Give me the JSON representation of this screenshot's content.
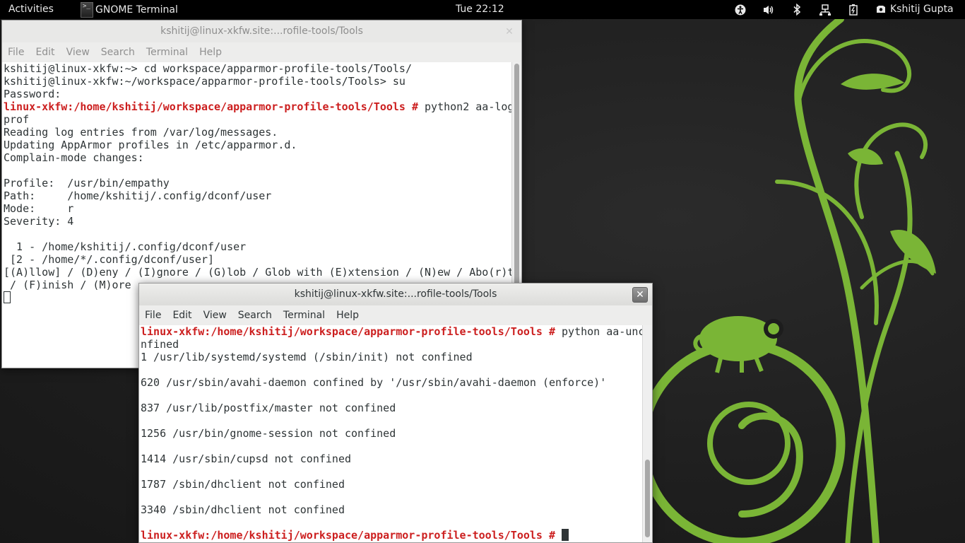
{
  "topbar": {
    "activities": "Activities",
    "app_name": "GNOME Terminal",
    "clock": "Tue 22:12",
    "user_name": "Kshitij Gupta",
    "tray_icons": [
      "accessibility-icon",
      "volume-icon",
      "bluetooth-icon",
      "network-icon",
      "battery-icon"
    ]
  },
  "menu": [
    "File",
    "Edit",
    "View",
    "Search",
    "Terminal",
    "Help"
  ],
  "window1": {
    "title": "kshitij@linux-xkfw.site:...rofile-tools/Tools",
    "lines": [
      {
        "text": "kshitij@linux-xkfw:~> cd workspace/apparmor-profile-tools/Tools/"
      },
      {
        "text": "kshitij@linux-xkfw:~/workspace/apparmor-profile-tools/Tools> su"
      },
      {
        "text": "Password:"
      },
      {
        "prompt": "linux-xkfw:/home/kshitij/workspace/apparmor-profile-tools/Tools #",
        "text": " python2 aa-log"
      },
      {
        "text": "prof"
      },
      {
        "text": "Reading log entries from /var/log/messages."
      },
      {
        "text": "Updating AppArmor profiles in /etc/apparmor.d."
      },
      {
        "text": "Complain-mode changes:"
      },
      {
        "text": ""
      },
      {
        "text": "Profile:  /usr/bin/empathy"
      },
      {
        "text": "Path:     /home/kshitij/.config/dconf/user"
      },
      {
        "text": "Mode:     r"
      },
      {
        "text": "Severity: 4"
      },
      {
        "text": ""
      },
      {
        "text": "  1 - /home/kshitij/.config/dconf/user"
      },
      {
        "text": " [2 - /home/*/.config/dconf/user]"
      },
      {
        "text": "[(A)llow] / (D)eny / (I)gnore / (G)lob / Glob with (E)xtension / (N)ew / Abo(r)t"
      },
      {
        "text": " / (F)inish / (M)ore"
      }
    ]
  },
  "window2": {
    "title": "kshitij@linux-xkfw.site:...rofile-tools/Tools",
    "lines": [
      {
        "prompt": "linux-xkfw:/home/kshitij/workspace/apparmor-profile-tools/Tools #",
        "text": " python aa-unc"
      },
      {
        "text": "nfined"
      },
      {
        "text": "1 /usr/lib/systemd/systemd (/sbin/init) not confined"
      },
      {
        "text": ""
      },
      {
        "text": "620 /usr/sbin/avahi-daemon confined by '/usr/sbin/avahi-daemon (enforce)'"
      },
      {
        "text": ""
      },
      {
        "text": "837 /usr/lib/postfix/master not confined"
      },
      {
        "text": ""
      },
      {
        "text": "1256 /usr/bin/gnome-session not confined"
      },
      {
        "text": ""
      },
      {
        "text": "1414 /usr/sbin/cupsd not confined"
      },
      {
        "text": ""
      },
      {
        "text": "1787 /sbin/dhclient not confined"
      },
      {
        "text": ""
      },
      {
        "text": "3340 /sbin/dhclient not confined"
      },
      {
        "text": ""
      },
      {
        "prompt": "linux-xkfw:/home/kshitij/workspace/apparmor-profile-tools/Tools #",
        "text": " ",
        "cursor": true
      }
    ]
  }
}
